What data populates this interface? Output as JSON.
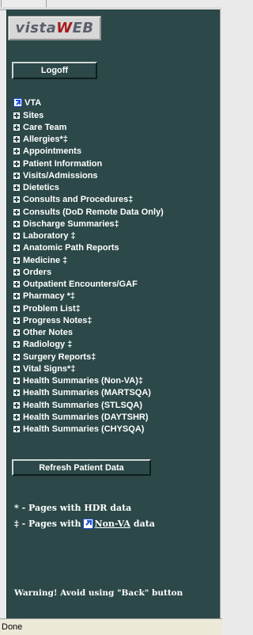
{
  "logo": {
    "part1": "vista",
    "part2": "W",
    "part3": "EB"
  },
  "buttons": {
    "logoff": "Logoff",
    "refresh": "Refresh Patient Data"
  },
  "tree": {
    "root": "VTA",
    "items": [
      "Sites",
      "Care Team",
      "Allergies*‡",
      "Appointments",
      "Patient Information",
      "Visits/Admissions",
      "Dietetics",
      "Consults and Procedures‡",
      "Consults (DoD Remote Data Only)",
      "Discharge Summaries‡",
      "Laboratory ‡",
      "Anatomic Path Reports",
      "Medicine ‡",
      "Orders",
      "Outpatient Encounters/GAF",
      "Pharmacy *‡",
      "Problem List‡",
      "Progress Notes‡",
      "Other Notes",
      "Radiology ‡",
      "Surgery Reports‡",
      "Vital Signs*‡",
      "Health Summaries (Non-VA)‡",
      "Health Summaries (MARTSQA)",
      "Health Summaries (STLSQA)",
      "Health Summaries (DAYTSHR)",
      "Health Summaries (CHYSQA)"
    ]
  },
  "legend": {
    "hdr": "* - Pages with HDR data",
    "nonva_prefix": "‡ - Pages with",
    "nonva_link": "Non-VA",
    "nonva_suffix": "data"
  },
  "warning": "Warning! Avoid using \"Back\" button",
  "status": "Done",
  "colors": {
    "panel": "#2c4848",
    "text": "#ffffff",
    "link_icon": "#1d4fd0",
    "logo_red": "#a51a1a"
  }
}
